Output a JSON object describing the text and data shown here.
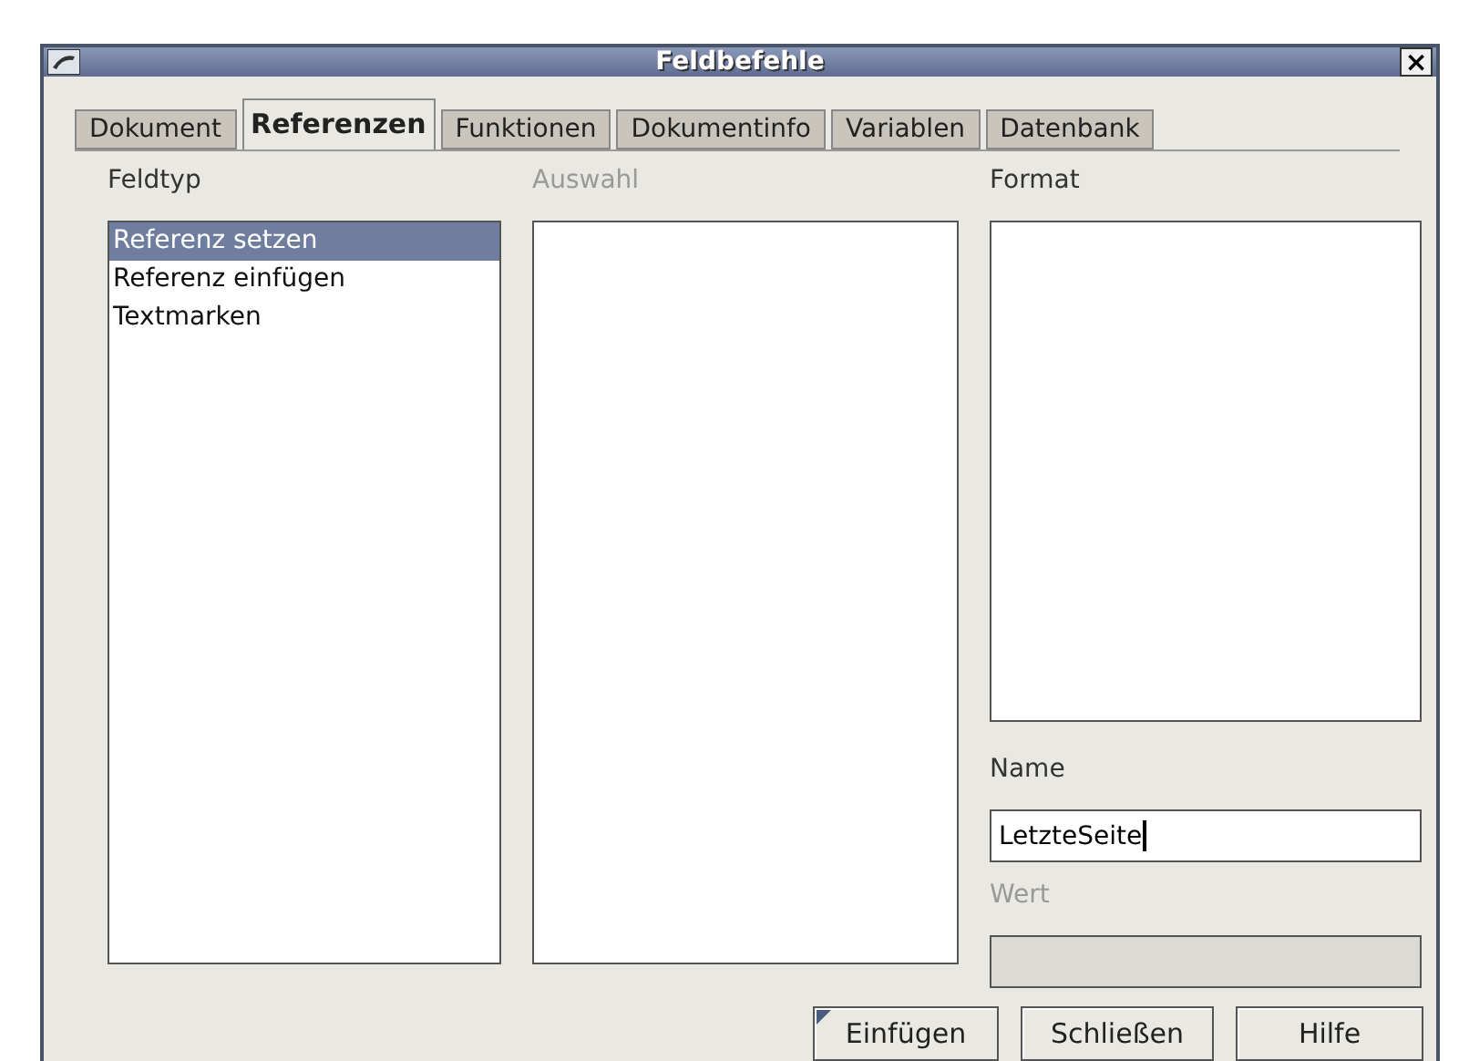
{
  "window": {
    "title": "Feldbefehle",
    "close": "×"
  },
  "tabs": [
    {
      "label": "Dokument",
      "selected": false
    },
    {
      "label": "Referenzen",
      "selected": true
    },
    {
      "label": "Funktionen",
      "selected": false
    },
    {
      "label": "Dokumentinfo",
      "selected": false
    },
    {
      "label": "Variablen",
      "selected": false
    },
    {
      "label": "Datenbank",
      "selected": false
    }
  ],
  "feldtyp": {
    "label": "Feldtyp",
    "disabled": false,
    "items": [
      {
        "label": "Referenz setzen",
        "selected": true
      },
      {
        "label": "Referenz einfügen",
        "selected": false
      },
      {
        "label": "Textmarken",
        "selected": false
      }
    ]
  },
  "auswahl": {
    "label": "Auswahl",
    "disabled": true
  },
  "format": {
    "label": "Format",
    "disabled": false
  },
  "name": {
    "label": "Name",
    "value": "LetzteSeite",
    "disabled": false
  },
  "wert": {
    "label": "Wert",
    "disabled": true
  },
  "buttons": [
    {
      "label": "Einfügen",
      "default": true
    },
    {
      "label": "Schließen",
      "default": false
    },
    {
      "label": "Hilfe",
      "default": false
    }
  ]
}
